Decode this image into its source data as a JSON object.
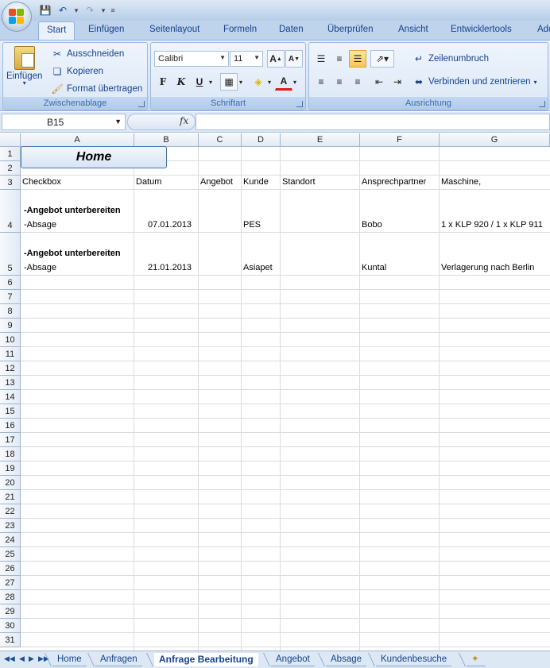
{
  "qat": {
    "save_icon": "save-icon",
    "undo_icon": "undo-icon",
    "redo_icon": "redo-icon",
    "customize_icon": "customize-icon"
  },
  "tabs": [
    "Start",
    "Einfügen",
    "Seitenlayout",
    "Formeln",
    "Daten",
    "Überprüfen",
    "Ansicht",
    "Entwicklertools",
    "Add"
  ],
  "ribbon": {
    "clipboard": {
      "paste": "Einfügen",
      "cut": "Ausschneiden",
      "copy": "Kopieren",
      "format_painter": "Format übertragen",
      "label": "Zwischenablage"
    },
    "font": {
      "name": "Calibri",
      "size": "11",
      "bold": "F",
      "italic": "K",
      "underline": "U",
      "label": "Schriftart"
    },
    "alignment": {
      "wrap": "Zeilenumbruch",
      "merge": "Verbinden und zentrieren",
      "label": "Ausrichtung"
    }
  },
  "formula_bar": {
    "name_box": "B15",
    "fx": "fx",
    "content": ""
  },
  "columns": [
    "A",
    "B",
    "C",
    "D",
    "E",
    "F",
    "G"
  ],
  "rows": [
    "1",
    "2",
    "3",
    "4",
    "5",
    "6",
    "7",
    "8",
    "9",
    "10",
    "11",
    "12",
    "13",
    "14",
    "15",
    "16",
    "17",
    "18",
    "19",
    "20",
    "21",
    "22",
    "23",
    "24",
    "25",
    "26",
    "27",
    "28",
    "29",
    "30",
    "31"
  ],
  "home_button": "Home",
  "headers": {
    "a": "Checkbox",
    "b": "Datum",
    "c": "Angebot",
    "d": "Kunde",
    "e": "Standort",
    "f": "Ansprechpartner",
    "g": "Maschine,"
  },
  "records": [
    {
      "line1": "-Angebot unterbereiten",
      "line2": "-Absage",
      "datum": "07.01.2013",
      "kunde": "PES",
      "ansprechpartner": "Bobo",
      "maschine": "1 x KLP 920 / 1 x KLP 911"
    },
    {
      "line1": "-Angebot unterbereiten",
      "line2": "-Absage",
      "datum": "21.01.2013",
      "kunde": "Asiapet",
      "ansprechpartner": "Kuntal",
      "maschine": "Verlagerung nach Berlin"
    }
  ],
  "sheet_tabs": [
    "Home",
    "Anfragen",
    "Anfrage Bearbeitung",
    "Angebot",
    "Absage",
    "Kundenbesuche"
  ],
  "active_sheet": "Anfrage Bearbeitung"
}
